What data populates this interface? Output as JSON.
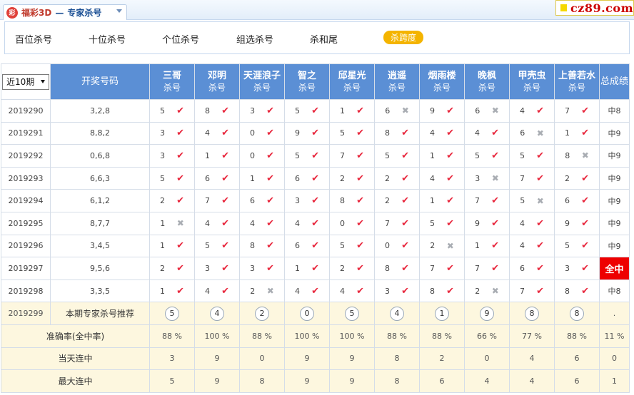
{
  "header": {
    "lottery": "福彩3D",
    "separator": "—",
    "section": "专家杀号",
    "brand": "cz89.com"
  },
  "tabs": [
    {
      "label": "百位杀号",
      "active": false
    },
    {
      "label": "十位杀号",
      "active": false
    },
    {
      "label": "个位杀号",
      "active": false
    },
    {
      "label": "组选杀号",
      "active": false
    },
    {
      "label": "杀和尾",
      "active": false
    },
    {
      "label": "杀跨度",
      "active": true
    }
  ],
  "table": {
    "period_select": "近10期",
    "draw_col": "开奖号码",
    "total_col": "总成绩",
    "kill_suffix": "杀号",
    "experts": [
      "三哥",
      "邓明",
      "天涯浪子",
      "智之",
      "邱星光",
      "逍遥",
      "烟雨楼",
      "晚枫",
      "甲壳虫",
      "上善若水"
    ],
    "rows": [
      {
        "issue": "2019290",
        "draw": "3,2,8",
        "kills": [
          [
            5,
            1
          ],
          [
            8,
            1
          ],
          [
            3,
            1
          ],
          [
            5,
            1
          ],
          [
            1,
            1
          ],
          [
            6,
            0
          ],
          [
            9,
            1
          ],
          [
            6,
            0
          ],
          [
            4,
            1
          ],
          [
            7,
            1
          ]
        ],
        "total": "中8",
        "full": false
      },
      {
        "issue": "2019291",
        "draw": "8,8,2",
        "kills": [
          [
            3,
            1
          ],
          [
            4,
            1
          ],
          [
            0,
            1
          ],
          [
            9,
            1
          ],
          [
            5,
            1
          ],
          [
            8,
            1
          ],
          [
            4,
            1
          ],
          [
            4,
            1
          ],
          [
            6,
            0
          ],
          [
            1,
            1
          ]
        ],
        "total": "中9",
        "full": false
      },
      {
        "issue": "2019292",
        "draw": "0,6,8",
        "kills": [
          [
            3,
            1
          ],
          [
            1,
            1
          ],
          [
            0,
            1
          ],
          [
            5,
            1
          ],
          [
            7,
            1
          ],
          [
            5,
            1
          ],
          [
            1,
            1
          ],
          [
            5,
            1
          ],
          [
            5,
            1
          ],
          [
            8,
            0
          ]
        ],
        "total": "中9",
        "full": false
      },
      {
        "issue": "2019293",
        "draw": "6,6,3",
        "kills": [
          [
            5,
            1
          ],
          [
            6,
            1
          ],
          [
            1,
            1
          ],
          [
            6,
            1
          ],
          [
            2,
            1
          ],
          [
            2,
            1
          ],
          [
            4,
            1
          ],
          [
            3,
            0
          ],
          [
            7,
            1
          ],
          [
            2,
            1
          ]
        ],
        "total": "中9",
        "full": false
      },
      {
        "issue": "2019294",
        "draw": "6,1,2",
        "kills": [
          [
            2,
            1
          ],
          [
            7,
            1
          ],
          [
            6,
            1
          ],
          [
            3,
            1
          ],
          [
            8,
            1
          ],
          [
            2,
            1
          ],
          [
            1,
            1
          ],
          [
            7,
            1
          ],
          [
            5,
            0
          ],
          [
            6,
            1
          ]
        ],
        "total": "中9",
        "full": false
      },
      {
        "issue": "2019295",
        "draw": "8,7,7",
        "kills": [
          [
            1,
            0
          ],
          [
            4,
            1
          ],
          [
            4,
            1
          ],
          [
            4,
            1
          ],
          [
            0,
            1
          ],
          [
            7,
            1
          ],
          [
            5,
            1
          ],
          [
            9,
            1
          ],
          [
            4,
            1
          ],
          [
            9,
            1
          ]
        ],
        "total": "中9",
        "full": false
      },
      {
        "issue": "2019296",
        "draw": "3,4,5",
        "kills": [
          [
            1,
            1
          ],
          [
            5,
            1
          ],
          [
            8,
            1
          ],
          [
            6,
            1
          ],
          [
            5,
            1
          ],
          [
            0,
            1
          ],
          [
            2,
            0
          ],
          [
            1,
            1
          ],
          [
            4,
            1
          ],
          [
            5,
            1
          ]
        ],
        "total": "中9",
        "full": false
      },
      {
        "issue": "2019297",
        "draw": "9,5,6",
        "kills": [
          [
            2,
            1
          ],
          [
            3,
            1
          ],
          [
            3,
            1
          ],
          [
            1,
            1
          ],
          [
            2,
            1
          ],
          [
            8,
            1
          ],
          [
            7,
            1
          ],
          [
            7,
            1
          ],
          [
            6,
            1
          ],
          [
            3,
            1
          ]
        ],
        "total": "全中",
        "full": true
      },
      {
        "issue": "2019298",
        "draw": "3,3,5",
        "kills": [
          [
            1,
            1
          ],
          [
            4,
            1
          ],
          [
            2,
            0
          ],
          [
            4,
            1
          ],
          [
            4,
            1
          ],
          [
            3,
            1
          ],
          [
            8,
            1
          ],
          [
            2,
            0
          ],
          [
            7,
            1
          ],
          [
            8,
            1
          ]
        ],
        "total": "中8",
        "full": false
      }
    ],
    "recommend": {
      "issue": "2019299",
      "label": "本期专家杀号推荐",
      "values": [
        "5",
        "4",
        "2",
        "0",
        "5",
        "4",
        "1",
        "9",
        "8",
        "8"
      ],
      "total": "."
    },
    "stats": [
      {
        "label": "准确率(全中率)",
        "values": [
          "88 %",
          "100 %",
          "88 %",
          "100 %",
          "100 %",
          "88 %",
          "88 %",
          "66 %",
          "77 %",
          "88 %"
        ],
        "total": "11 %"
      },
      {
        "label": "当天连中",
        "values": [
          "3",
          "9",
          "0",
          "9",
          "9",
          "8",
          "2",
          "0",
          "4",
          "6"
        ],
        "total": "0"
      },
      {
        "label": "最大连中",
        "values": [
          "5",
          "9",
          "8",
          "9",
          "9",
          "8",
          "6",
          "4",
          "4",
          "6"
        ],
        "total": "1"
      }
    ]
  }
}
